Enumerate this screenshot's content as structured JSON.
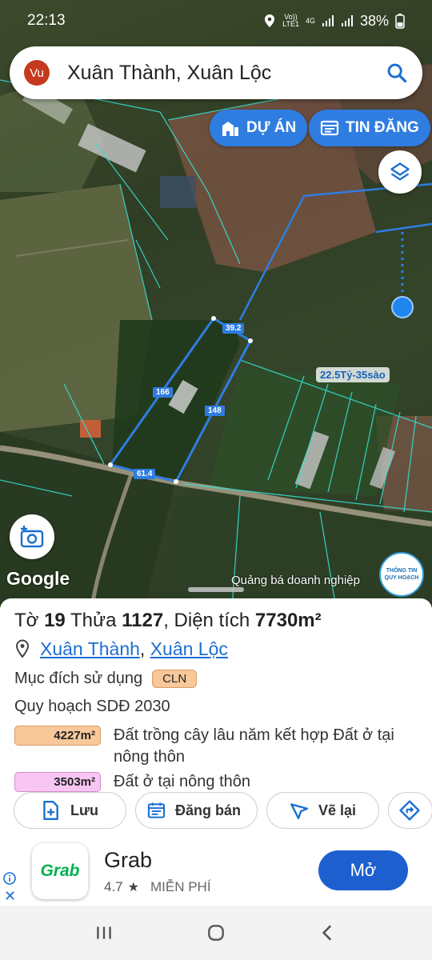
{
  "status": {
    "time": "22:13",
    "volte_top": "Vo))",
    "volte_bottom": "LTE1",
    "network": "4G",
    "battery": "38%"
  },
  "search": {
    "avatar_initials": "Vu",
    "query": "Xuân Thành, Xuân Lộc"
  },
  "map": {
    "pill_projects": "DỰ ÁN",
    "pill_listings": "TIN ĐĂNG",
    "edge_labels": [
      "39.2",
      "166",
      "148",
      "61.4"
    ],
    "price_label": "22.5Tỷ-35sào",
    "google_label": "Google",
    "promo_text": "Quảng bá doanh nghiệp",
    "planning_badge_line1": "THÔNG TIN",
    "planning_badge_line2": "QUY HOẠCH"
  },
  "parcel": {
    "sheet_label": "Tờ",
    "sheet_number": "19",
    "plot_label": "Thửa",
    "plot_number": "1127",
    "area_label": ", Diện tích",
    "area_value": "7730m²",
    "commune": "Xuân Thành",
    "separator": ",",
    "district": "Xuân Lộc",
    "land_use_label": "Mục đích sử dụng",
    "land_use_code": "CLN",
    "plan_label": "Quy hoạch SDĐ 2030",
    "zones": [
      {
        "area": "4227m²",
        "description": "Đất trồng cây lâu năm kết hợp Đất ở tại nông thôn",
        "color": "#f8c89a"
      },
      {
        "area": "3503m²",
        "description": "Đất ở tại nông thôn",
        "color": "#f8c6f3"
      }
    ]
  },
  "actions": {
    "save": "Lưu",
    "post_sale": "Đăng bán",
    "redraw": "Vẽ lại"
  },
  "ad": {
    "logo_text": "Grab",
    "app_name": "Grab",
    "rating": "4.7",
    "star": "★",
    "price": "MIỄN PHÍ",
    "open_button": "Mở",
    "close": "✕"
  }
}
